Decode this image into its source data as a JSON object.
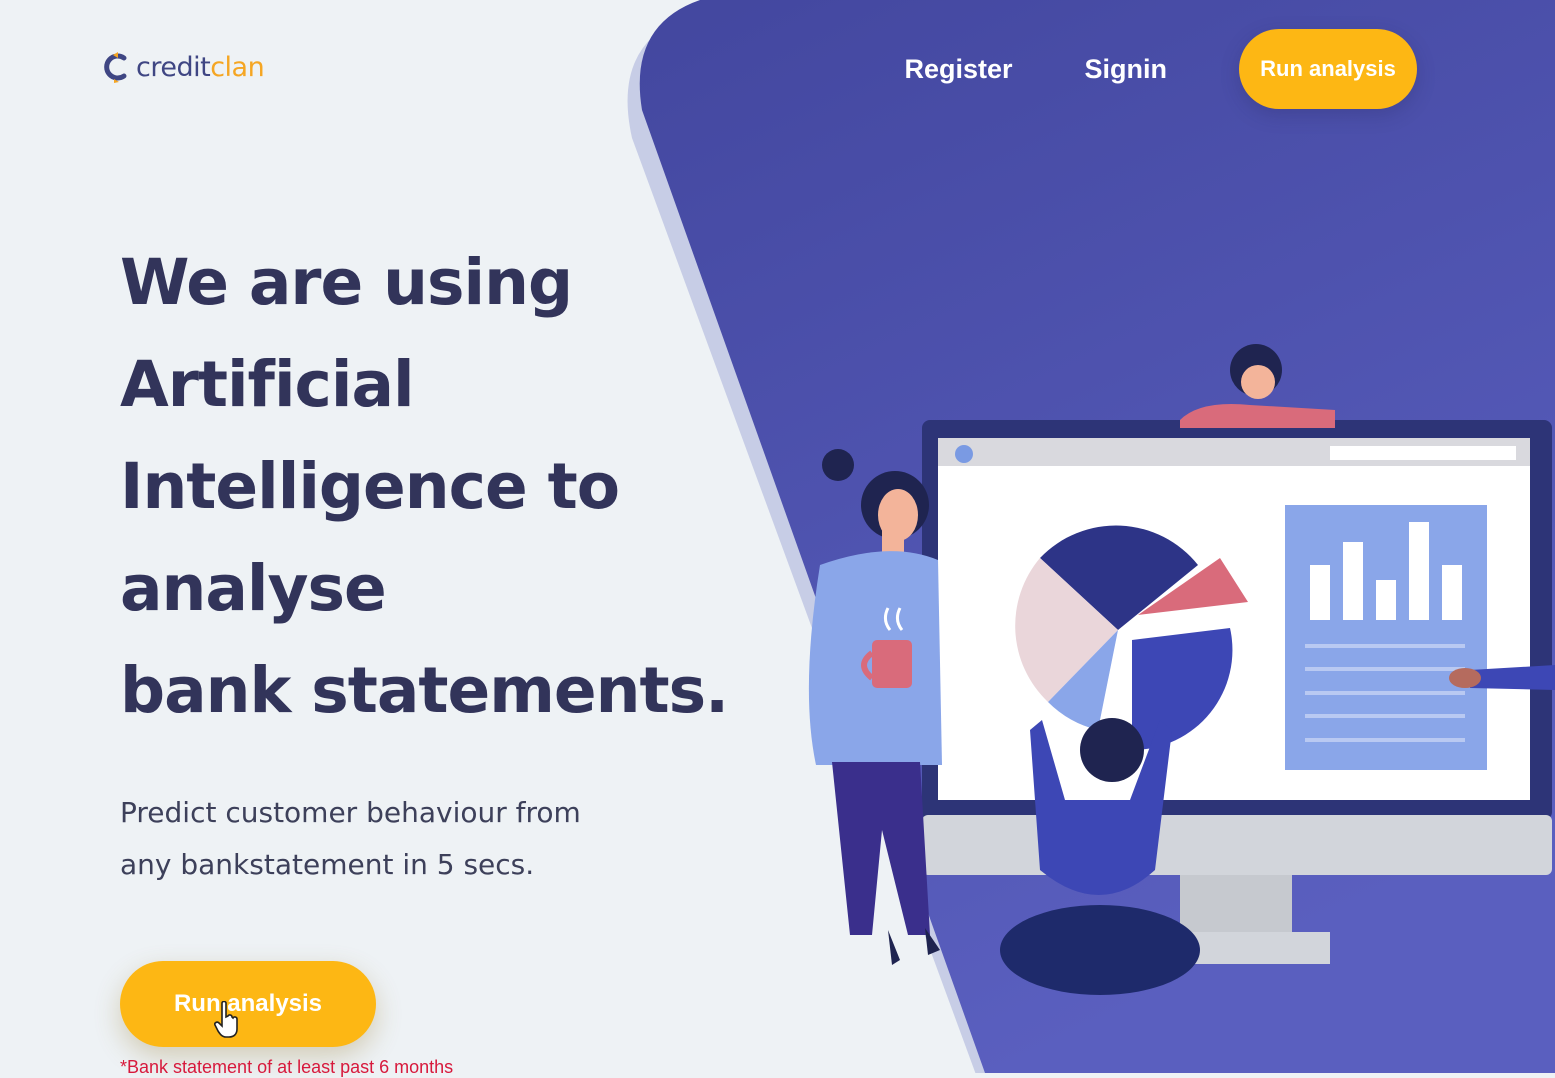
{
  "brand": {
    "name_part1": "credit",
    "name_part2": "clan"
  },
  "nav": {
    "register": "Register",
    "signin": "Signin",
    "cta": "Run analysis"
  },
  "hero": {
    "title_lines": [
      "We are using",
      "Artificial",
      "Intelligence to",
      "analyse",
      "bank statements."
    ],
    "subtitle_line1": "Predict customer behaviour from",
    "subtitle_line2": "any bankstatement in 5 secs.",
    "cta": "Run analysis",
    "disclaimer": "*Bank statement of at least past 6 months"
  },
  "colors": {
    "accent": "#fdb714",
    "panel": "#4a4fa8",
    "text_dark": "#32345a",
    "background": "#eef2f5",
    "warning": "#d7193c"
  },
  "icons": {
    "logo": "creditclan-logo-icon",
    "cursor": "hand-pointer-icon"
  }
}
